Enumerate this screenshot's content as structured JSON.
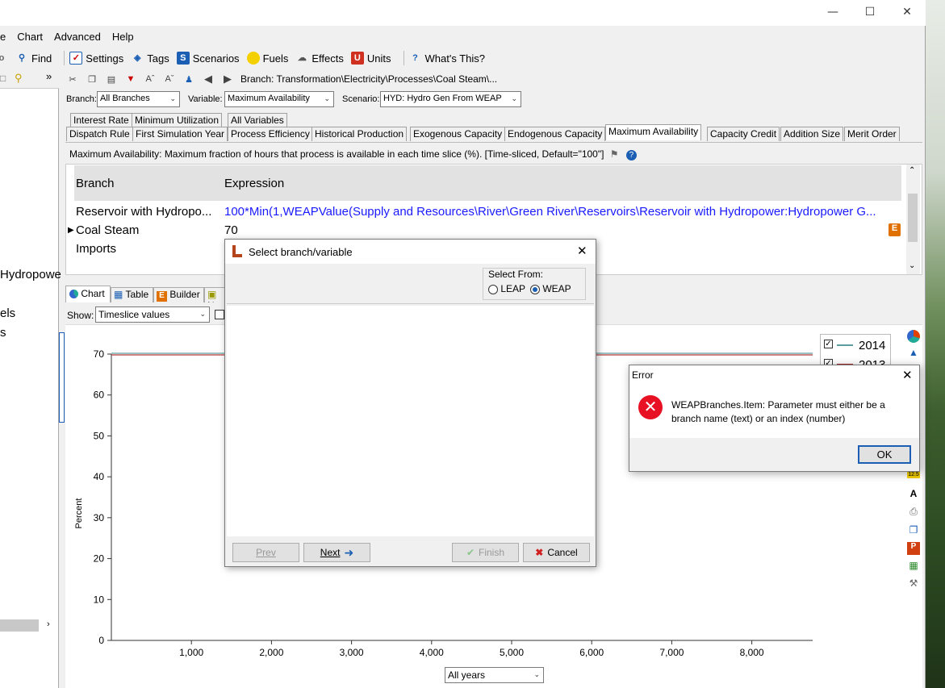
{
  "menu": [
    "e",
    "Chart",
    "Advanced",
    "Help"
  ],
  "toolbar": {
    "find": "Find",
    "settings": "Settings",
    "tags": "Tags",
    "scenarios": "Scenarios",
    "fuels": "Fuels",
    "effects": "Effects",
    "units": "Units",
    "whats_this": "What's This?"
  },
  "branch_path": "Branch: Transformation\\Electricity\\Processes\\Coal Steam\\...",
  "filters": {
    "branch_label": "Branch:",
    "branch_value": "All Branches",
    "variable_label": "Variable:",
    "variable_value": "Maximum Availability",
    "scenario_label": "Scenario:",
    "scenario_value": "HYD: Hydro Gen From WEAP"
  },
  "tabs_row1": [
    "Interest Rate",
    "Minimum Utilization",
    "All Variables"
  ],
  "tabs_row2": [
    "Dispatch Rule",
    "First Simulation Year",
    "Process Efficiency",
    "Historical Production",
    "Exogenous Capacity",
    "Endogenous Capacity",
    "Maximum Availability",
    "Capacity Credit",
    "Addition Size",
    "Merit Order"
  ],
  "description": "Maximum Availability: Maximum fraction of hours that process is available in each time slice (%). [Time-sliced, Default=\"100\"]",
  "grid": {
    "col_branch": "Branch",
    "col_expression": "Expression",
    "rows": [
      {
        "branch": "Reservoir with Hydropo...",
        "expression": "100*Min(1,WEAPValue(Supply and Resources\\River\\Green River\\Reservoirs\\Reservoir with Hydropower:Hydropower G..."
      },
      {
        "branch": "Coal Steam",
        "expression": "70"
      },
      {
        "branch": "Imports",
        "expression": ""
      }
    ]
  },
  "left_panel": {
    "items": [
      "Hydropowe",
      "els",
      "s"
    ]
  },
  "bottom_tabs": [
    "Chart",
    "Table",
    "Builder",
    "N"
  ],
  "show_label": "Show:",
  "show_value": "Timeslice values",
  "chart": {
    "ylabel": "Percent",
    "y_ticks": [
      "70",
      "60",
      "50",
      "40",
      "30",
      "20",
      "10",
      "0"
    ],
    "x_ticks": [
      "1,000",
      "2,000",
      "3,000",
      "4,000",
      "5,000",
      "6,000",
      "7,000",
      "8,000"
    ],
    "legend": [
      "2014",
      "2013"
    ],
    "years_select": "All years"
  },
  "chart_data": {
    "type": "line",
    "ylabel": "Percent",
    "ylim": [
      0,
      70
    ],
    "xlim": [
      0,
      8760
    ],
    "series": [
      {
        "name": "2014",
        "x": [
          0,
          8760
        ],
        "values": [
          70,
          70
        ]
      },
      {
        "name": "2013",
        "x": [
          0,
          8760
        ],
        "values": [
          70,
          70
        ]
      }
    ]
  },
  "dialog": {
    "title": "Select branch/variable",
    "select_from_label": "Select From:",
    "opt_leap": "LEAP",
    "opt_weap": "WEAP",
    "prev": "Prev",
    "next": "Next",
    "finish": "Finish",
    "cancel": "Cancel"
  },
  "error": {
    "title": "Error",
    "message": "WEAPBranches.Item: Parameter must either be a branch name (text) or an index (number)",
    "ok": "OK"
  },
  "colors": {
    "expression_blue": "#1a1aff",
    "error_red": "#e81123",
    "line_teal": "#5b9e9e",
    "line_red": "#b03030"
  }
}
